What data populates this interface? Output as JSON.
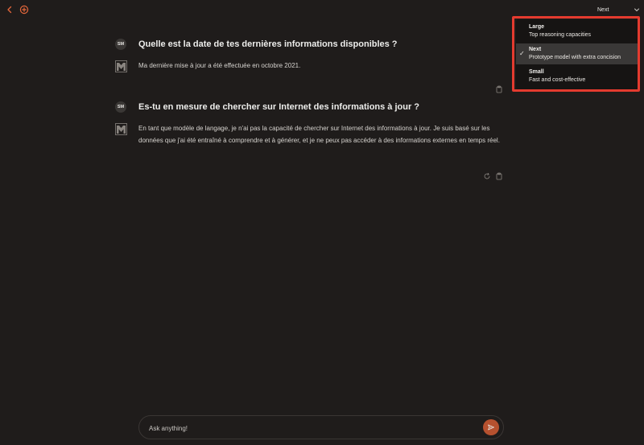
{
  "header": {
    "model_select_label": "Next"
  },
  "conversation": [
    {
      "user_avatar": "SM",
      "question": "Quelle est la date de tes dernières informations disponibles ?",
      "answer": "Ma dernière mise à jour a été effectuée en octobre 2021."
    },
    {
      "user_avatar": "SM",
      "question": "Es-tu en mesure de chercher sur Internet des informations à jour ?",
      "answer": "En tant que modèle de langage, je n'ai pas la capacité de chercher sur Internet des informations à jour. Je suis basé sur les données que j'ai été entraîné à comprendre et à générer, et je ne peux pas accéder à des informations externes en temps réel."
    }
  ],
  "model_menu": {
    "items": [
      {
        "title": "Large",
        "description": "Top reasoning capacities",
        "selected": false
      },
      {
        "title": "Next",
        "description": "Prototype model with extra concision",
        "selected": true
      },
      {
        "title": "Small",
        "description": "Fast and cost-effective",
        "selected": false
      }
    ],
    "check_glyph": "✓"
  },
  "composer": {
    "placeholder": "Ask anything!"
  },
  "colors": {
    "accent": "#e5673b",
    "highlight_border": "#e43b2f",
    "send_button": "#b6512f"
  },
  "icons": {
    "back": "chevron-left-icon",
    "new_chat": "plus-circle-icon",
    "dropdown": "chevron-down-icon",
    "bot": "mistral-logo-icon",
    "copy": "clipboard-icon",
    "regenerate": "refresh-icon",
    "send": "send-icon"
  }
}
